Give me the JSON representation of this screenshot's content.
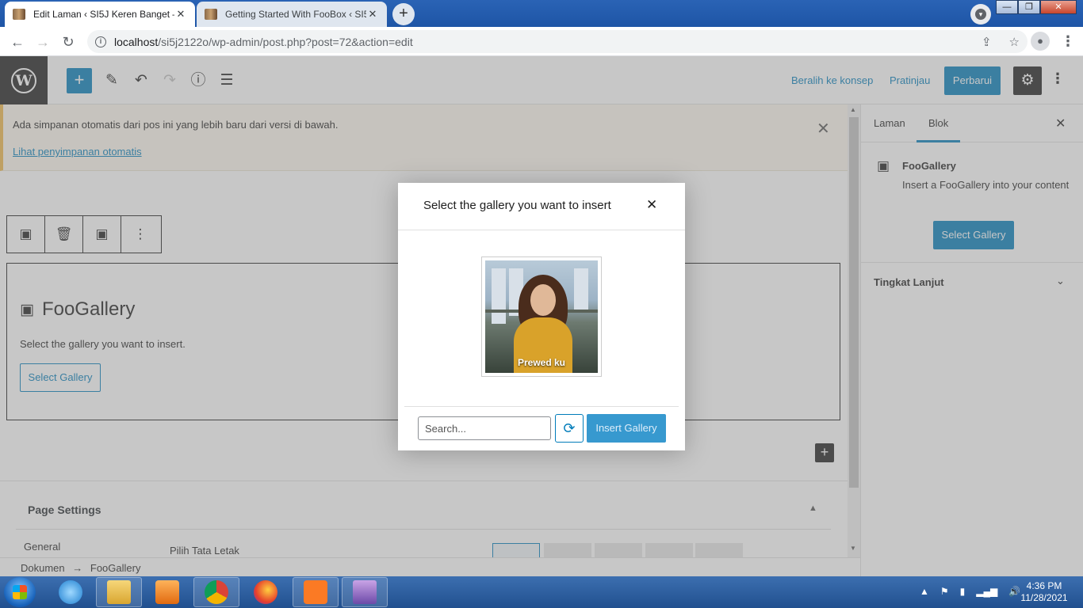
{
  "browser": {
    "tabs": [
      {
        "title": "Edit Laman ‹ SI5J Keren Banget —",
        "active": true
      },
      {
        "title": "Getting Started With FooBox ‹ SI5",
        "active": false
      }
    ],
    "url_host": "localhost",
    "url_path": "/si5j2122o/wp-admin/post.php?post=72&action=edit",
    "window_controls": {
      "minimize": "—",
      "maximize": "❐",
      "close": "✕"
    }
  },
  "editor_header": {
    "switch_draft": "Beralih ke konsep",
    "preview": "Pratinjau",
    "update": "Perbarui"
  },
  "notice": {
    "message": "Ada simpanan otomatis dari pos ini yang lebih baru dari versi di bawah.",
    "link": "Lihat penyimpanan otomatis"
  },
  "block": {
    "name": "FooGallery",
    "description": "Select the gallery you want to insert.",
    "select_button": "Select Gallery"
  },
  "page_settings": {
    "title": "Page Settings",
    "tab_general": "General",
    "layout_label": "Pilih Tata Letak"
  },
  "breadcrumbs": {
    "root": "Dokumen",
    "separator": "→",
    "current": "FooGallery"
  },
  "sidebar": {
    "tab_page": "Laman",
    "tab_block": "Blok",
    "block_name": "FooGallery",
    "block_desc": "Insert a FooGallery into your content",
    "select_button": "Select Gallery",
    "advanced": "Tingkat Lanjut"
  },
  "modal": {
    "title": "Select the gallery you want to insert",
    "gallery_caption": "Prewed ku",
    "search_placeholder": "Search...",
    "insert_button": "Insert Gallery"
  },
  "taskbar": {
    "time": "4:36 PM",
    "date": "11/28/2021"
  },
  "colors": {
    "wp_blue": "#007cba",
    "notice_accent": "#f0b849",
    "taskbar": "#21508f"
  }
}
